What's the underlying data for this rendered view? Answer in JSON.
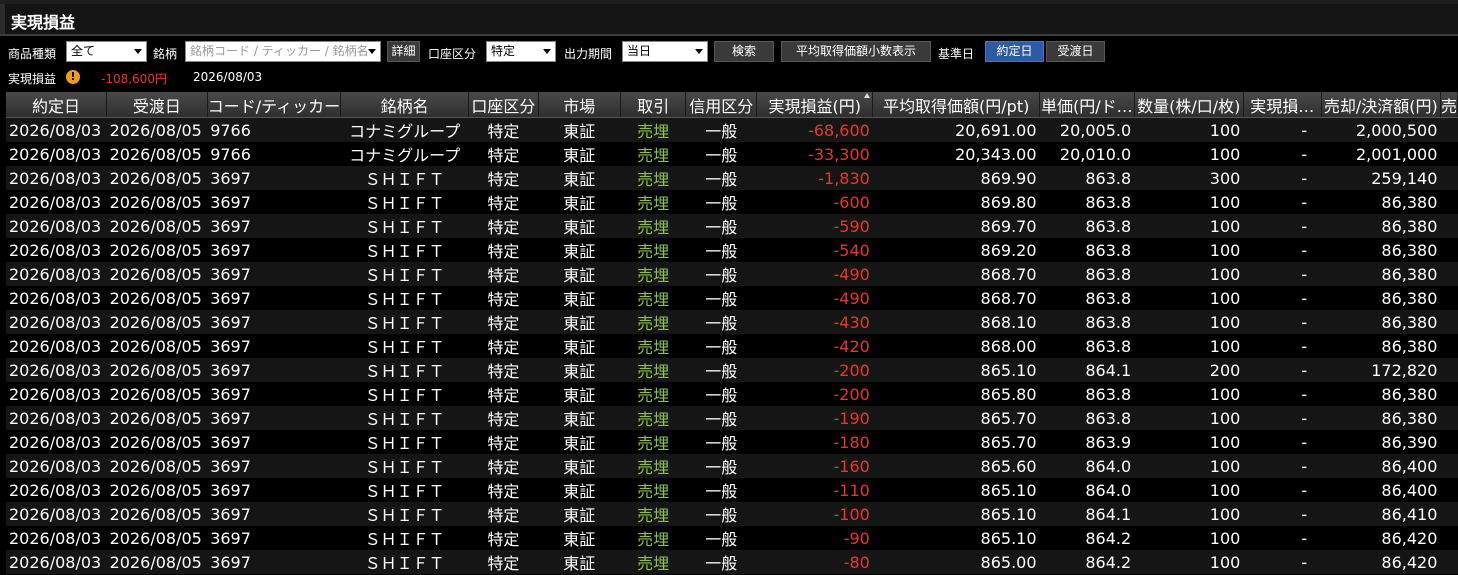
{
  "window": {
    "title": "実現損益"
  },
  "filters": {
    "product_type_label": "商品種類",
    "product_type_value": "全て",
    "stock_label": "銘柄",
    "stock_placeholder": "銘柄コード / ティッカー / 銘柄名",
    "detail_button": "詳細",
    "account_label": "口座区分",
    "account_value": "特定",
    "period_label": "出力期間",
    "period_value": "当日",
    "search_button": "検索",
    "decimal_button": "平均取得価額小数表示",
    "base_date_label": "基準日",
    "contract_date_button": "約定日",
    "delivery_date_button": "受渡日"
  },
  "summary": {
    "label": "実現損益",
    "warning_icon": "!",
    "value": "-108,600円",
    "date": "2026/08/03"
  },
  "colors": {
    "negative": "#e8362c",
    "sell": "#8cc43a",
    "selected_button": "#2f5ba6"
  },
  "table": {
    "columns": [
      "約定日",
      "受渡日",
      "コード/ティッカー",
      "銘柄名",
      "口座区分",
      "市場",
      "取引",
      "信用区分",
      "実現損益(円)",
      "平均取得価額(円/pt)",
      "単価(円/ド…",
      "数量(株/口/枚)",
      "実現損…",
      "売却/決済額(円)",
      "売"
    ],
    "rows": [
      [
        "2026/08/03",
        "2026/08/05",
        "9766",
        "コナミグループ",
        "特定",
        "東証",
        "売埋",
        "一般",
        "-68,600",
        "20,691.00",
        "20,005.0",
        "100",
        "-",
        "2,000,500"
      ],
      [
        "2026/08/03",
        "2026/08/05",
        "9766",
        "コナミグループ",
        "特定",
        "東証",
        "売埋",
        "一般",
        "-33,300",
        "20,343.00",
        "20,010.0",
        "100",
        "-",
        "2,001,000"
      ],
      [
        "2026/08/03",
        "2026/08/05",
        "3697",
        "ＳＨＩＦＴ",
        "特定",
        "東証",
        "売埋",
        "一般",
        "-1,830",
        "869.90",
        "863.8",
        "300",
        "-",
        "259,140"
      ],
      [
        "2026/08/03",
        "2026/08/05",
        "3697",
        "ＳＨＩＦＴ",
        "特定",
        "東証",
        "売埋",
        "一般",
        "-600",
        "869.80",
        "863.8",
        "100",
        "-",
        "86,380"
      ],
      [
        "2026/08/03",
        "2026/08/05",
        "3697",
        "ＳＨＩＦＴ",
        "特定",
        "東証",
        "売埋",
        "一般",
        "-590",
        "869.70",
        "863.8",
        "100",
        "-",
        "86,380"
      ],
      [
        "2026/08/03",
        "2026/08/05",
        "3697",
        "ＳＨＩＦＴ",
        "特定",
        "東証",
        "売埋",
        "一般",
        "-540",
        "869.20",
        "863.8",
        "100",
        "-",
        "86,380"
      ],
      [
        "2026/08/03",
        "2026/08/05",
        "3697",
        "ＳＨＩＦＴ",
        "特定",
        "東証",
        "売埋",
        "一般",
        "-490",
        "868.70",
        "863.8",
        "100",
        "-",
        "86,380"
      ],
      [
        "2026/08/03",
        "2026/08/05",
        "3697",
        "ＳＨＩＦＴ",
        "特定",
        "東証",
        "売埋",
        "一般",
        "-490",
        "868.70",
        "863.8",
        "100",
        "-",
        "86,380"
      ],
      [
        "2026/08/03",
        "2026/08/05",
        "3697",
        "ＳＨＩＦＴ",
        "特定",
        "東証",
        "売埋",
        "一般",
        "-430",
        "868.10",
        "863.8",
        "100",
        "-",
        "86,380"
      ],
      [
        "2026/08/03",
        "2026/08/05",
        "3697",
        "ＳＨＩＦＴ",
        "特定",
        "東証",
        "売埋",
        "一般",
        "-420",
        "868.00",
        "863.8",
        "100",
        "-",
        "86,380"
      ],
      [
        "2026/08/03",
        "2026/08/05",
        "3697",
        "ＳＨＩＦＴ",
        "特定",
        "東証",
        "売埋",
        "一般",
        "-200",
        "865.10",
        "864.1",
        "200",
        "-",
        "172,820"
      ],
      [
        "2026/08/03",
        "2026/08/05",
        "3697",
        "ＳＨＩＦＴ",
        "特定",
        "東証",
        "売埋",
        "一般",
        "-200",
        "865.80",
        "863.8",
        "100",
        "-",
        "86,380"
      ],
      [
        "2026/08/03",
        "2026/08/05",
        "3697",
        "ＳＨＩＦＴ",
        "特定",
        "東証",
        "売埋",
        "一般",
        "-190",
        "865.70",
        "863.8",
        "100",
        "-",
        "86,380"
      ],
      [
        "2026/08/03",
        "2026/08/05",
        "3697",
        "ＳＨＩＦＴ",
        "特定",
        "東証",
        "売埋",
        "一般",
        "-180",
        "865.70",
        "863.9",
        "100",
        "-",
        "86,390"
      ],
      [
        "2026/08/03",
        "2026/08/05",
        "3697",
        "ＳＨＩＦＴ",
        "特定",
        "東証",
        "売埋",
        "一般",
        "-160",
        "865.60",
        "864.0",
        "100",
        "-",
        "86,400"
      ],
      [
        "2026/08/03",
        "2026/08/05",
        "3697",
        "ＳＨＩＦＴ",
        "特定",
        "東証",
        "売埋",
        "一般",
        "-110",
        "865.10",
        "864.0",
        "100",
        "-",
        "86,400"
      ],
      [
        "2026/08/03",
        "2026/08/05",
        "3697",
        "ＳＨＩＦＴ",
        "特定",
        "東証",
        "売埋",
        "一般",
        "-100",
        "865.10",
        "864.1",
        "100",
        "-",
        "86,410"
      ],
      [
        "2026/08/03",
        "2026/08/05",
        "3697",
        "ＳＨＩＦＴ",
        "特定",
        "東証",
        "売埋",
        "一般",
        "-90",
        "865.10",
        "864.2",
        "100",
        "-",
        "86,420"
      ],
      [
        "2026/08/03",
        "2026/08/05",
        "3697",
        "ＳＨＩＦＴ",
        "特定",
        "東証",
        "売埋",
        "一般",
        "-80",
        "865.00",
        "864.2",
        "100",
        "-",
        "86,420"
      ]
    ]
  }
}
